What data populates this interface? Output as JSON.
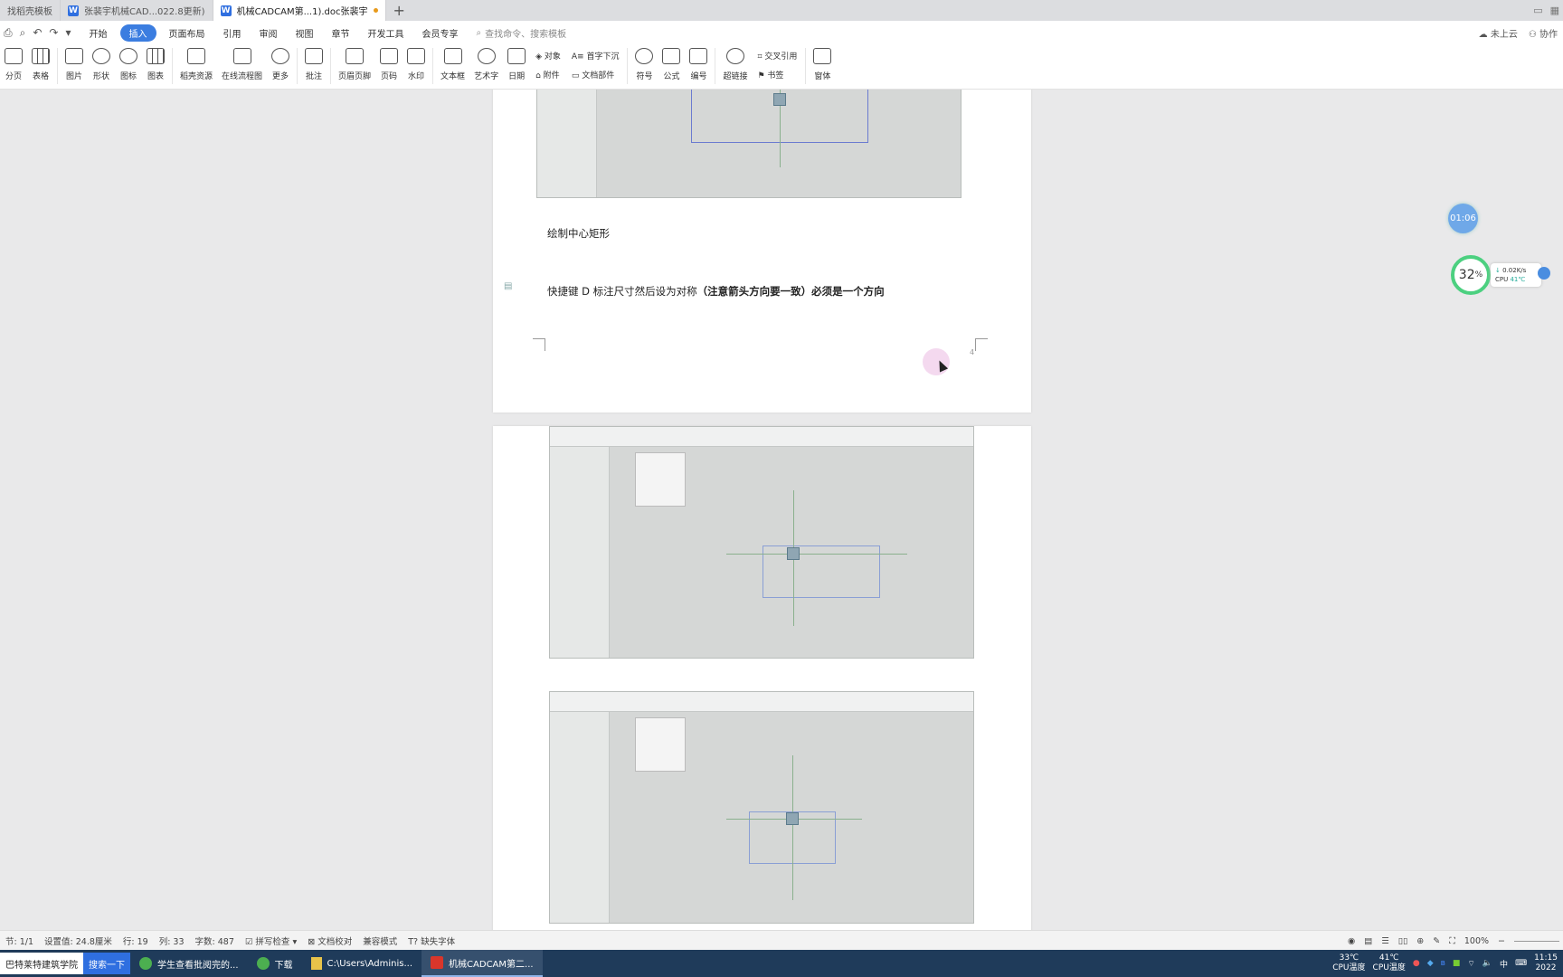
{
  "tabs": [
    {
      "label": "找稻壳模板",
      "active": false
    },
    {
      "label": "张裴宇机械CAD...022.8更新)",
      "active": false
    },
    {
      "label": "机械CADCAM第...1).doc张裴宇",
      "active": true
    }
  ],
  "menu": {
    "items": [
      "开始",
      "插入",
      "页面布局",
      "引用",
      "审阅",
      "视图",
      "章节",
      "开发工具",
      "会员专享"
    ],
    "active": "插入",
    "search_placeholder": "查找命令、搜索模板",
    "right": [
      "未上云",
      "协作"
    ]
  },
  "ribbon": {
    "buttons": [
      "分页",
      "表格",
      "图片",
      "形状",
      "图标",
      "图表",
      "稻壳资源",
      "在线流程图",
      "更多",
      "批注",
      "页眉页脚",
      "页码",
      "水印",
      "文本框",
      "艺术字",
      "日期"
    ],
    "stack1": [
      "对象",
      "附件"
    ],
    "stack2": [
      "首字下沉",
      "文档部件"
    ],
    "buttons2": [
      "符号",
      "公式",
      "编号",
      "超链接"
    ],
    "stack3": [
      "交叉引用",
      "书签"
    ],
    "buttons3": [
      "窗体"
    ]
  },
  "document": {
    "para1": "绘制中心矩形",
    "para2_normal": "快捷键 D 标注尺寸然后设为对称",
    "para2_bold": "（注意箭头方向要一致）必须是一个方向",
    "page_mark": "4"
  },
  "statusbar": {
    "section": "节: 1/1",
    "setting": "设置值: 24.8厘米",
    "row": "行: 19",
    "col": "列: 33",
    "words": "字数: 487",
    "spell": "拼写检查",
    "proof": "文档校对",
    "compat": "兼容模式",
    "missing_font": "缺失字体",
    "zoom": "100%"
  },
  "taskbar": {
    "search_text": "巴特莱特建筑学院",
    "search_btn": "搜索一下",
    "items": [
      {
        "label": "学生查看批阅完的...",
        "icon": "chat-icon",
        "active": false
      },
      {
        "label": "下载",
        "icon": "chat-icon",
        "active": false
      },
      {
        "label": "C:\\Users\\Adminis...",
        "icon": "folder-icon",
        "active": false
      },
      {
        "label": "机械CADCAM第二...",
        "icon": "wps-icon",
        "active": true
      }
    ],
    "temp1_value": "33℃",
    "temp1_label": "CPU温度",
    "temp2_value": "41℃",
    "temp2_label": "CPU温度",
    "ime": "中",
    "clock": "11:15",
    "date": "2022"
  },
  "widgets": {
    "timer": "01:06",
    "cpu_percent": "32",
    "net_speed": "0.02K/s",
    "cpu_label": "CPU",
    "cpu_temp": "41℃"
  },
  "colors": {
    "accent": "#3b7de0",
    "taskbar": "#1f3b5a",
    "cpu_ring": "#4cd080"
  }
}
